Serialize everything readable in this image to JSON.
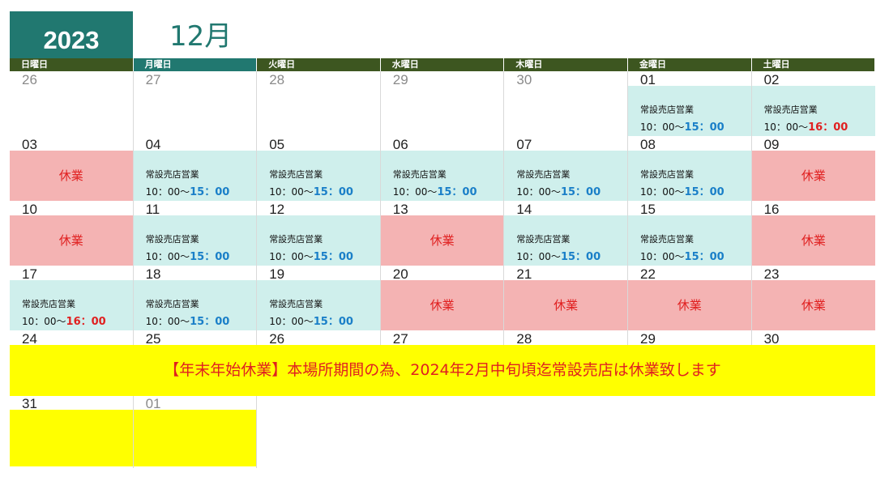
{
  "header": {
    "year": "2023",
    "month": "12月"
  },
  "colors": {
    "accent": "#217870",
    "weekday_bar": "#3d5620",
    "open_bg": "#cfefec",
    "closed_bg": "#f4b3b3",
    "notice_bg": "#ffff00",
    "closed_text": "#e02020",
    "hours_end_blue": "#1a7fc8"
  },
  "weekdays": [
    "日曜日",
    "月曜日",
    "火曜日",
    "水曜日",
    "木曜日",
    "金曜日",
    "土曜日"
  ],
  "labels": {
    "closed": "休業",
    "open": "常設売店営業",
    "hours_start": "10：00～",
    "end_15": "15：00",
    "end_16": "16：00"
  },
  "notice": "【年末年始休業】本場所期間の為、2024年2月中旬頃迄常設売店は休業致します",
  "weeks": [
    [
      {
        "day": "26",
        "other": true,
        "status": "none"
      },
      {
        "day": "27",
        "other": true,
        "status": "none"
      },
      {
        "day": "28",
        "other": true,
        "status": "none"
      },
      {
        "day": "29",
        "other": true,
        "status": "none"
      },
      {
        "day": "30",
        "other": true,
        "status": "none"
      },
      {
        "day": "01",
        "other": false,
        "status": "open",
        "end": "15"
      },
      {
        "day": "02",
        "other": false,
        "status": "open",
        "end": "16"
      }
    ],
    [
      {
        "day": "03",
        "other": false,
        "status": "closed"
      },
      {
        "day": "04",
        "other": false,
        "status": "open",
        "end": "15"
      },
      {
        "day": "05",
        "other": false,
        "status": "open",
        "end": "15"
      },
      {
        "day": "06",
        "other": false,
        "status": "open",
        "end": "15"
      },
      {
        "day": "07",
        "other": false,
        "status": "open",
        "end": "15"
      },
      {
        "day": "08",
        "other": false,
        "status": "open",
        "end": "15"
      },
      {
        "day": "09",
        "other": false,
        "status": "closed"
      }
    ],
    [
      {
        "day": "10",
        "other": false,
        "status": "closed"
      },
      {
        "day": "11",
        "other": false,
        "status": "open",
        "end": "15"
      },
      {
        "day": "12",
        "other": false,
        "status": "open",
        "end": "15"
      },
      {
        "day": "13",
        "other": false,
        "status": "closed"
      },
      {
        "day": "14",
        "other": false,
        "status": "open",
        "end": "15"
      },
      {
        "day": "15",
        "other": false,
        "status": "open",
        "end": "15"
      },
      {
        "day": "16",
        "other": false,
        "status": "closed"
      }
    ],
    [
      {
        "day": "17",
        "other": false,
        "status": "open",
        "end": "16"
      },
      {
        "day": "18",
        "other": false,
        "status": "open",
        "end": "15"
      },
      {
        "day": "19",
        "other": false,
        "status": "open",
        "end": "15"
      },
      {
        "day": "20",
        "other": false,
        "status": "closed"
      },
      {
        "day": "21",
        "other": false,
        "status": "closed"
      },
      {
        "day": "22",
        "other": false,
        "status": "closed"
      },
      {
        "day": "23",
        "other": false,
        "status": "closed"
      }
    ],
    [
      {
        "day": "24",
        "other": false,
        "status": "notice"
      },
      {
        "day": "25",
        "other": false,
        "status": "notice"
      },
      {
        "day": "26",
        "other": false,
        "status": "notice"
      },
      {
        "day": "27",
        "other": false,
        "status": "notice"
      },
      {
        "day": "28",
        "other": false,
        "status": "notice"
      },
      {
        "day": "29",
        "other": false,
        "status": "notice"
      },
      {
        "day": "30",
        "other": false,
        "status": "notice"
      }
    ],
    [
      {
        "day": "31",
        "other": false,
        "status": "yellow"
      },
      {
        "day": "01",
        "other": true,
        "status": "yellow"
      }
    ]
  ]
}
